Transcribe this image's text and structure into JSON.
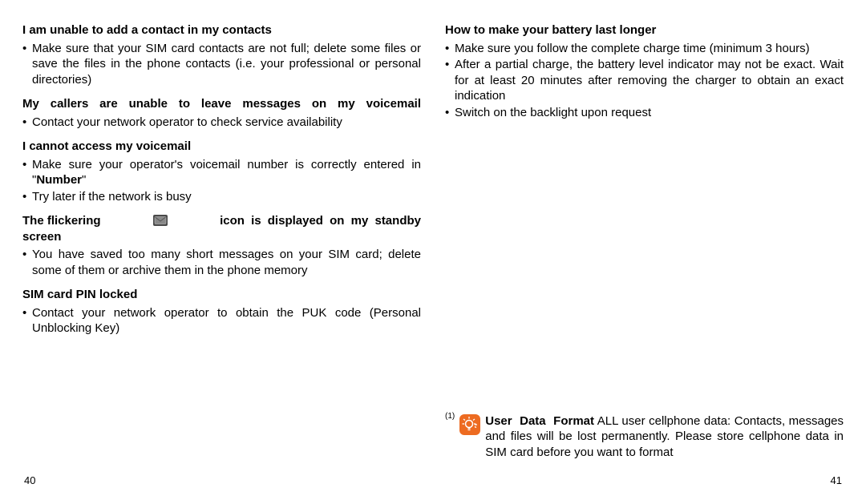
{
  "left": {
    "sec1": {
      "heading": "I am unable to add a contact in my contacts",
      "items": [
        "Make sure that your SIM card contacts are not full; delete some files or save the files in the phone contacts (i.e. your professional or personal directories)"
      ]
    },
    "sec2": {
      "heading": "My callers are unable to leave messages on my voicemail",
      "items": [
        "Contact your network operator to check service availability"
      ]
    },
    "sec3": {
      "heading": "I cannot access my voicemail",
      "items_html": [
        "Make sure your operator's voicemail number is correctly entered in \"<span class='bold'>Number</span>\"",
        "Try later if the network is busy"
      ]
    },
    "sec4": {
      "heading_part1": "The flickering",
      "heading_part2": "icon is displayed on my standby",
      "heading_part3": "screen",
      "items": [
        "You have saved too many short messages on your SIM card; delete some of them or archive them in the phone memory"
      ]
    },
    "sec5": {
      "heading": "SIM card PIN locked",
      "items": [
        "Contact your network operator to obtain the PUK code (Personal Unblocking Key)"
      ]
    }
  },
  "right": {
    "sec1": {
      "heading": "How to make your battery last longer",
      "items": [
        "Make sure you follow the complete charge time (minimum 3 hours)",
        "After a partial charge, the battery level indicator may not be exact. Wait for at least 20 minutes after removing the charger to obtain an exact indication",
        "Switch on the backlight upon request"
      ]
    },
    "footnote": {
      "num": "(1)",
      "bold": "User Data Format",
      "text": " ALL user cellphone data: Contacts, messages and files will be lost permanently. Please store cellphone data in SIM card before you want to format"
    }
  },
  "colors": {
    "orange": "#ed6b21"
  },
  "pages": {
    "left": "40",
    "right": "41"
  }
}
